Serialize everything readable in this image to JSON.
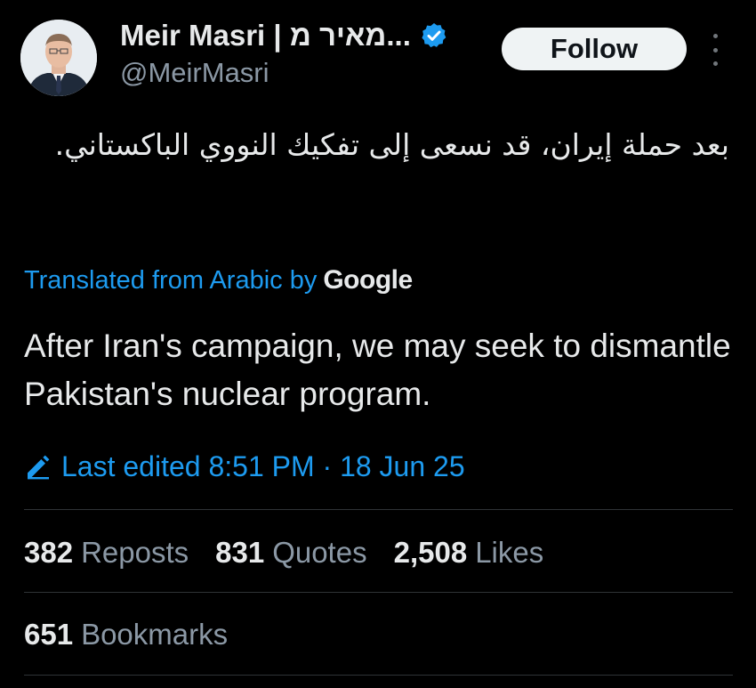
{
  "author": {
    "display_name": "Meir Masri | מאיר מ...",
    "handle": "@MeirMasri",
    "verified_icon": "verified-badge-icon"
  },
  "follow_label": "Follow",
  "tweet": {
    "original_text": "بعد حملة إيران، قد نسعى إلى تفكيك النووي الباكستاني.",
    "translated_from": "Translated from Arabic by",
    "translator_logo": "Google",
    "translation": "After Iran's campaign, we may seek to dismantle Pakistan's nuclear program.",
    "edited_label": "Last edited 8:51 PM · 18 Jun 25"
  },
  "stats": {
    "reposts": {
      "value": "382",
      "label": "Reposts"
    },
    "quotes": {
      "value": "831",
      "label": "Quotes"
    },
    "likes": {
      "value": "2,508",
      "label": "Likes"
    },
    "bookmarks": {
      "value": "651",
      "label": "Bookmarks"
    }
  },
  "colors": {
    "background": "#000000",
    "text": "#e7e9ea",
    "secondary": "#8b98a5",
    "accent": "#1d9bf0",
    "button_bg": "#eff3f4"
  }
}
